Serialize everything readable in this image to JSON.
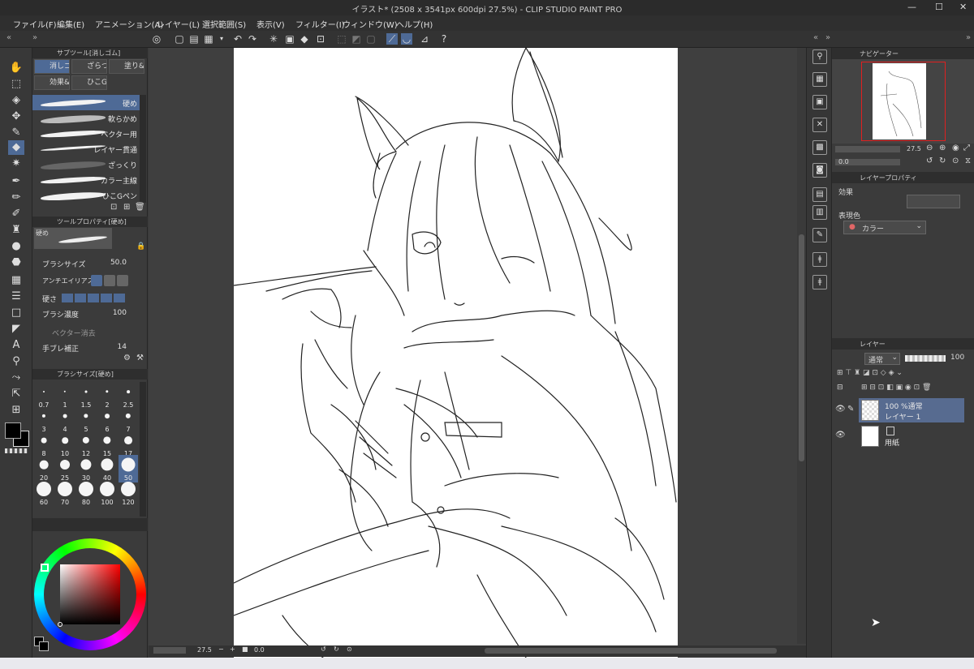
{
  "window": {
    "title": "イラスト* (2508 x 3541px 600dpi 27.5%)  - CLIP STUDIO PAINT PRO"
  },
  "window_controls": {
    "minimize": "—",
    "maximize": "☐",
    "close": "✕"
  },
  "menu": [
    "ファイル(F)",
    "編集(E)",
    "アニメーション(A)",
    "レイヤー(L)",
    "選択範囲(S)",
    "表示(V)",
    "フィルター(I)",
    "ウィンドウ(W)",
    "ヘルプ(H)"
  ],
  "subtool_panel": {
    "title": "サブツール[消しゴム]",
    "tabs": [
      "消しゴ",
      "ざらつ",
      "塗り&",
      "効果&",
      "ひこG"
    ],
    "brushes": [
      "硬め",
      "軟らかめ",
      "ベクター用",
      "レイヤー貫通",
      "ざっくり",
      "カラー主線",
      "ひこGペン"
    ],
    "selected_brush": 0
  },
  "tool_property": {
    "title": "ツールプロパティ[硬め]",
    "preset_name": "硬め",
    "brush_size_label": "ブラシサイズ",
    "brush_size_value": "50.0",
    "antialias_label": "アンチエイリアス",
    "hardness_label": "硬さ",
    "density_label": "ブラシ濃度",
    "density_value": "100",
    "vector_erase_label": "ベクター消去",
    "stabilize_label": "手ブレ補正",
    "stabilize_value": "14"
  },
  "brush_size_panel": {
    "title": "ブラシサイズ[硬め]",
    "sizes": [
      "0.7",
      "1",
      "1.5",
      "2",
      "2.5",
      "3",
      "4",
      "5",
      "6",
      "7",
      "8",
      "10",
      "12",
      "15",
      "17",
      "20",
      "25",
      "30",
      "40",
      "50",
      "60",
      "70",
      "80",
      "100",
      "120"
    ],
    "selected": "50"
  },
  "color": {
    "main": "#000000",
    "sub": "#ffffff",
    "wheel_base": "#ff0000"
  },
  "canvas": {
    "zoom": "27.5",
    "rotation": "0.0"
  },
  "navigator": {
    "title": "ナビゲーター",
    "zoom": "27.5",
    "rotation": "0.0"
  },
  "layer_property": {
    "title": "レイヤープロパティ",
    "effect_label": "効果",
    "expression_label": "表現色",
    "expression_value": "カラー"
  },
  "layer_panel": {
    "title": "レイヤー",
    "blend_mode": "通常",
    "opacity": "100",
    "layers": [
      {
        "line1": "100 %通常",
        "line2": "レイヤー 1",
        "selected": true
      },
      {
        "line1": "",
        "line2": "用紙",
        "selected": false
      }
    ]
  }
}
